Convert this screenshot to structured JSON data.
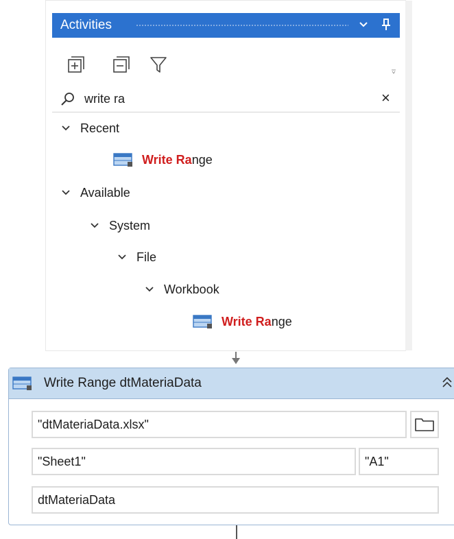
{
  "activities_panel": {
    "title": "Activities",
    "search": {
      "value": "write ra",
      "clear_label": "×"
    },
    "tree": {
      "recent_label": "Recent",
      "recent_item": {
        "highlight": "Write Ra",
        "rest": "nge"
      },
      "available_label": "Available",
      "system_label": "System",
      "file_label": "File",
      "workbook_label": "Workbook",
      "workbook_item": {
        "highlight": "Write Ra",
        "rest": "nge"
      }
    }
  },
  "sequence_card": {
    "title": "Write Range dtMateriaData",
    "workbook_path": "\"dtMateriaData.xlsx\"",
    "sheet_name": "\"Sheet1\"",
    "starting_cell": "\"A1\"",
    "datatable": "dtMateriaData"
  },
  "colors": {
    "panel_title_bg": "#2c72cf",
    "match_highlight": "#d01e1e",
    "card_header_bg": "#c7dcf0"
  }
}
